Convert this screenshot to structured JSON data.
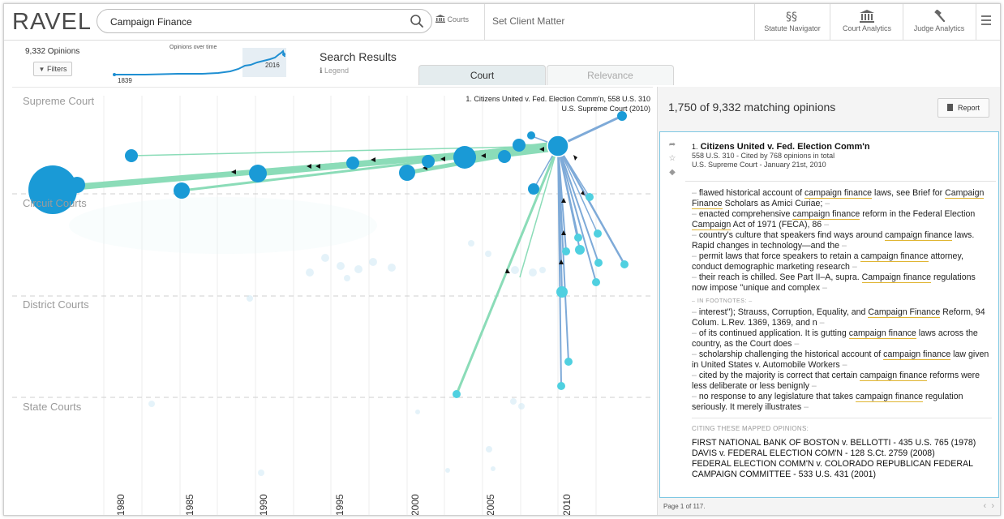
{
  "app": {
    "logo": "RAVEL"
  },
  "search": {
    "value": "Campaign Finance",
    "courts_label": "Courts"
  },
  "topbar": {
    "client_matter": "Set Client Matter",
    "statute_navigator": "Statute Navigator",
    "court_analytics": "Court Analytics",
    "judge_analytics": "Judge Analytics"
  },
  "summary": {
    "opinions": "9,332 Opinions",
    "filters": "Filters"
  },
  "timeline": {
    "title": "Opinions over time",
    "start_year": "1839",
    "end_year": "2016"
  },
  "results": {
    "title": "Search Results",
    "legend": "Legend",
    "tab_court": "Court",
    "tab_relevance": "Relevance"
  },
  "graph": {
    "tiers": [
      "Supreme Court",
      "Circuit Courts",
      "District Courts",
      "State Courts"
    ],
    "years": [
      "1980",
      "1985",
      "1990",
      "1995",
      "2000",
      "2005",
      "2010"
    ],
    "top_case_line1": "1. Citizens United v. Fed. Election Comm'n, 558 U.S. 310",
    "top_case_line2": "U.S. Supreme Court (2010)",
    "colors": {
      "blue": "#1a9ad6",
      "cyan": "#4fd0e0",
      "green": "#8bdcb8",
      "steel": "#7eaad8"
    }
  },
  "panel": {
    "match_text": "1,750 of 9,332 matching opinions",
    "report": "Report",
    "case_number": "1.",
    "case_title": "Citizens United v. Fed. Election Comm'n",
    "case_cite": "558 U.S. 310 - Cited by 768 opinions in total",
    "case_court": "U.S. Supreme Court - January 21st, 2010",
    "in_footnotes": "IN FOOTNOTES:",
    "citing_header": "CITING THESE MAPPED OPINIONS:",
    "citing": [
      "FIRST NATIONAL BANK OF BOSTON v. BELLOTTI - 435 U.S. 765 (1978)",
      "DAVIS v. FEDERAL ELECTION COM'N - 128 S.Ct. 2759 (2008)",
      "FEDERAL ELECTION COMM'N v. COLORADO REPUBLICAN FEDERAL CAMPAIGN COMMITTEE - 533 U.S. 431 (2001)"
    ],
    "page_label": "Page 1 of 117."
  }
}
